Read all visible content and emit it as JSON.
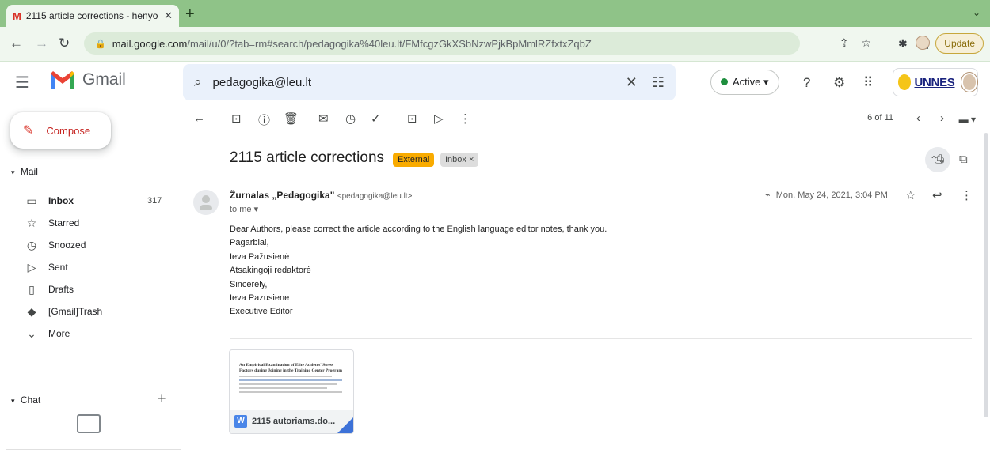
{
  "browser": {
    "tab_title": "2115 article corrections - henyo",
    "tab_favicon": "gmail-icon",
    "url_host": "mail.google.com",
    "url_path": "/mail/u/0/?tab=rm#search/pedagogika%40leu.lt/FMfcgzGkXSbNzwPjkBpMmlRZfxtxZqbZ",
    "update_label": "Update",
    "accent": "#8fc388"
  },
  "header": {
    "app_name": "Gmail",
    "search_query": "pedagogika@leu.lt",
    "status_label": "Active",
    "org_logo_text": "UNNES"
  },
  "sidebar": {
    "compose_label": "Compose",
    "mail_section": "Mail",
    "items": [
      {
        "label": "Inbox",
        "icon": "inbox-icon",
        "count": "317",
        "bold": true
      },
      {
        "label": "Starred",
        "icon": "star-icon",
        "count": ""
      },
      {
        "label": "Snoozed",
        "icon": "clock-icon",
        "count": ""
      },
      {
        "label": "Sent",
        "icon": "send-icon",
        "count": ""
      },
      {
        "label": "Drafts",
        "icon": "draft-icon",
        "count": ""
      },
      {
        "label": "[Gmail]Trash",
        "icon": "label-icon",
        "count": ""
      },
      {
        "label": "More",
        "icon": "chevron-down-icon",
        "count": ""
      }
    ],
    "chat_section": "Chat"
  },
  "toolbar": {
    "pager": "6 of 11"
  },
  "message": {
    "subject": "2115 article corrections",
    "badge_external": "External",
    "badge_inbox": "Inbox ×",
    "sender_name": "Žurnalas „Pedagogika\"",
    "sender_addr": "<pedagogika@leu.lt>",
    "to_line": "to me ▾",
    "date": "Mon, May 24, 2021, 3:04 PM",
    "body_lines": [
      "Dear Authors, please correct the article according to the English language editor notes, thank you.",
      "Pagarbiai,",
      "Ieva Pažusienė",
      "Atsakingoji redaktorė",
      "Sincerely,",
      "Ieva Pazusiene",
      "Executive Editor"
    ],
    "attachment": {
      "filename": "2115 autoriams.do...",
      "file_type": "W",
      "preview_title": "An Empirical Examination of Elite Athletes' Stress Factors during Joining in the Training Center Program"
    }
  }
}
